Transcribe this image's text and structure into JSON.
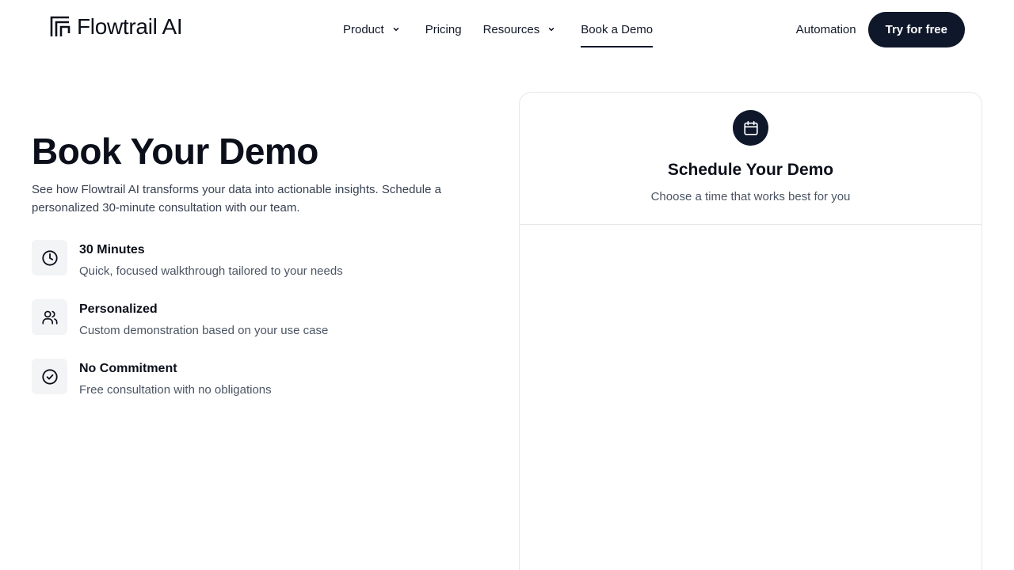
{
  "header": {
    "logo_text": "Flowtrail AI",
    "nav": {
      "product": "Product",
      "pricing": "Pricing",
      "resources": "Resources",
      "book_demo": "Book a Demo"
    },
    "automation": "Automation",
    "cta": "Try for free"
  },
  "hero": {
    "title": "Book Your Demo",
    "description": "See how Flowtrail AI transforms your data into actionable insights. Schedule a personalized 30-minute consultation with our team."
  },
  "features": [
    {
      "icon": "clock-icon",
      "title": "30 Minutes",
      "description": "Quick, focused walkthrough tailored to your needs"
    },
    {
      "icon": "users-icon",
      "title": "Personalized",
      "description": "Custom demonstration based on your use case"
    },
    {
      "icon": "check-circle-icon",
      "title": "No Commitment",
      "description": "Free consultation with no obligations"
    }
  ],
  "scheduler": {
    "icon": "calendar-icon",
    "title": "Schedule Your Demo",
    "subtitle": "Choose a time that works best for you"
  },
  "colors": {
    "primary": "#0f172a",
    "text_muted": "#4b5563",
    "icon_bg": "#f3f4f6",
    "border": "#e5e7eb"
  }
}
